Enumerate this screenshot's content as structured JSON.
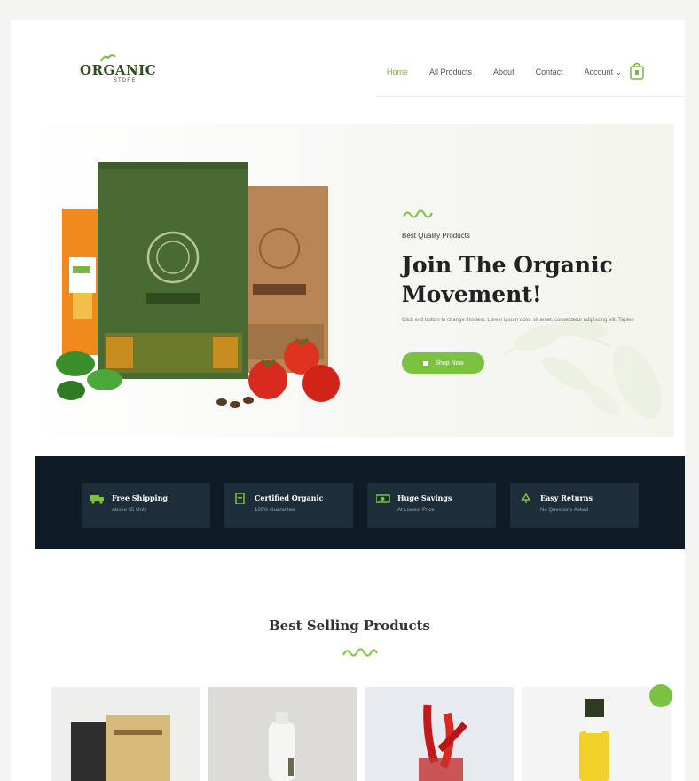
{
  "colors": {
    "accent": "#7cc242",
    "dark": "#0f1c26",
    "feature_box": "#1d2e3a"
  },
  "header": {
    "logo_text": "ORGANIC",
    "logo_sub": "STORE",
    "nav": [
      {
        "label": "Home",
        "active": true
      },
      {
        "label": "All Products",
        "active": false
      },
      {
        "label": "About",
        "active": false
      },
      {
        "label": "Contact",
        "active": false
      },
      {
        "label": "Account ⌄",
        "active": false
      }
    ],
    "cart_icon": "shopping-bag-icon"
  },
  "hero": {
    "eyebrow": "Best Quality Products",
    "title": "Join The Organic Movement!",
    "description": "Click edit button to change this text. Lorem ipsum dolor sit amet, consectetur adipiscing elit. Tapien",
    "button_label": "Shop Now",
    "button_icon": "cart-icon"
  },
  "features": [
    {
      "title": "Free Shipping",
      "subtitle": "Above $5 Only",
      "icon": "truck-icon"
    },
    {
      "title": "Certified Organic",
      "subtitle": "100% Guarantee",
      "icon": "certificate-icon"
    },
    {
      "title": "Huge Savings",
      "subtitle": "At Lowest Price",
      "icon": "money-icon"
    },
    {
      "title": "Easy Returns",
      "subtitle": "No Questions Asked",
      "icon": "recycle-icon"
    }
  ],
  "best_selling": {
    "title": "Best Selling Products",
    "products": [
      {
        "image": "coffee-bags"
      },
      {
        "image": "bottle"
      },
      {
        "image": "red-chilies"
      },
      {
        "image": "oil-bottle"
      }
    ]
  }
}
